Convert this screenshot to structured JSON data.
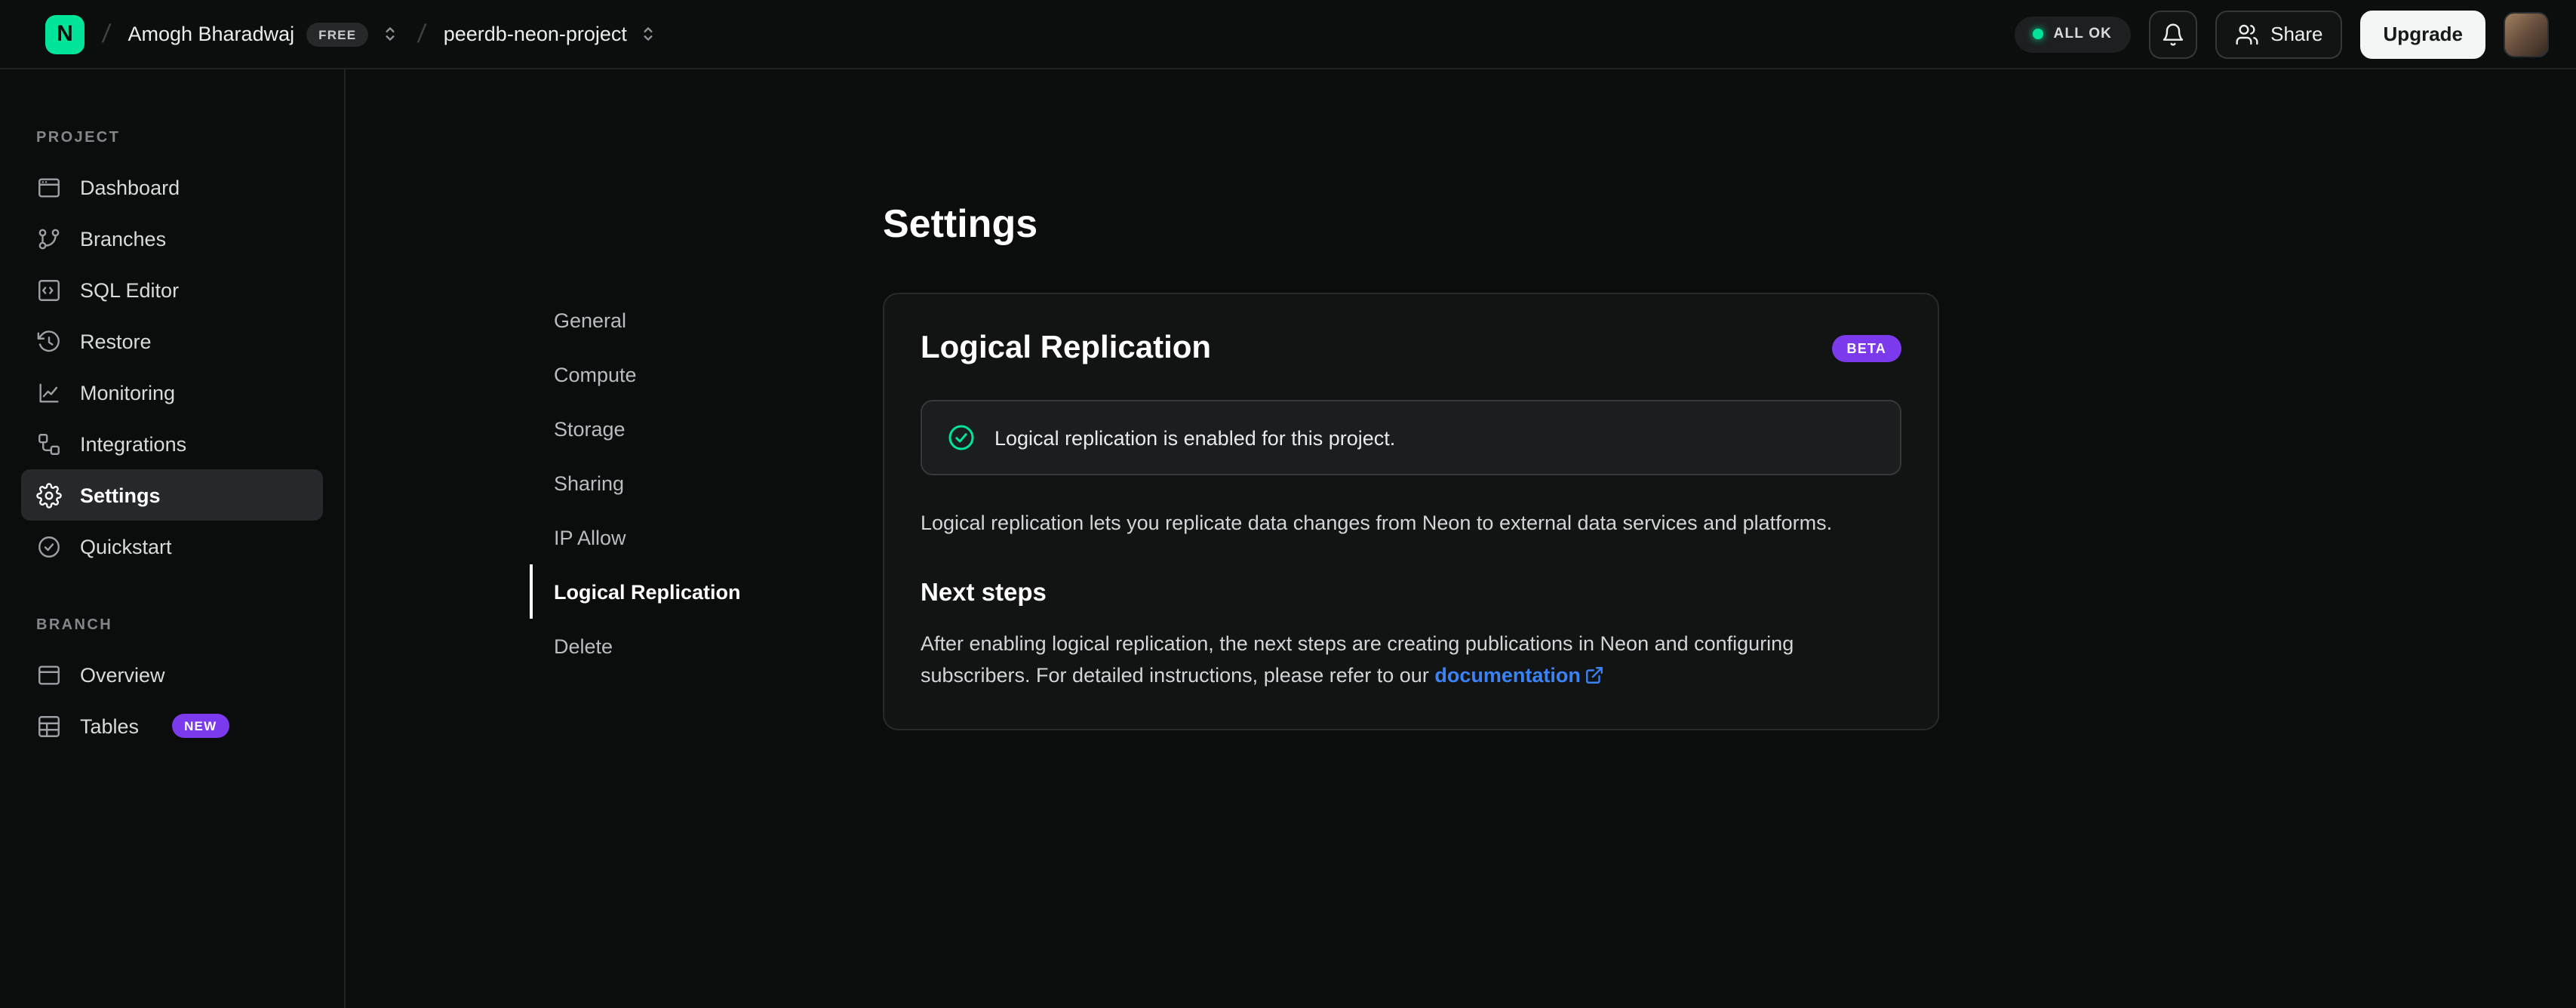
{
  "colors": {
    "green": "#00e599",
    "purple": "#7c3aed",
    "link": "#3b82f6"
  },
  "topbar": {
    "logo": "neon-logo",
    "org_name": "Amogh Bharadwaj",
    "org_badge": "FREE",
    "project_name": "peerdb-neon-project",
    "status_label": "ALL OK",
    "bell_icon": "bell-icon",
    "share_label": "Share",
    "upgrade_label": "Upgrade"
  },
  "sidebar": {
    "project_label": "PROJECT",
    "branch_label": "BRANCH",
    "project_items": [
      {
        "label": "Dashboard",
        "icon": "dashboard-icon"
      },
      {
        "label": "Branches",
        "icon": "branches-icon"
      },
      {
        "label": "SQL Editor",
        "icon": "sql-editor-icon"
      },
      {
        "label": "Restore",
        "icon": "restore-icon"
      },
      {
        "label": "Monitoring",
        "icon": "monitoring-icon"
      },
      {
        "label": "Integrations",
        "icon": "integrations-icon"
      },
      {
        "label": "Settings",
        "icon": "gear-icon",
        "active": true
      },
      {
        "label": "Quickstart",
        "icon": "check-circle-icon"
      }
    ],
    "branch_items": [
      {
        "label": "Overview",
        "icon": "overview-icon"
      },
      {
        "label": "Tables",
        "icon": "tables-icon",
        "badge": "NEW"
      }
    ]
  },
  "main": {
    "page_title": "Settings",
    "nav": [
      "General",
      "Compute",
      "Storage",
      "Sharing",
      "IP Allow",
      "Logical Replication",
      "Delete"
    ],
    "active_nav": "Logical Replication",
    "card": {
      "title": "Logical Replication",
      "badge": "BETA",
      "alert_text": "Logical replication is enabled for this project.",
      "intro": "Logical replication lets you replicate data changes from Neon to external data services and platforms.",
      "next_steps_title": "Next steps",
      "next_steps_text": "After enabling logical replication, the next steps are creating publications in Neon and configuring subscribers. For detailed instructions, please refer to our ",
      "doc_link": "documentation"
    }
  }
}
